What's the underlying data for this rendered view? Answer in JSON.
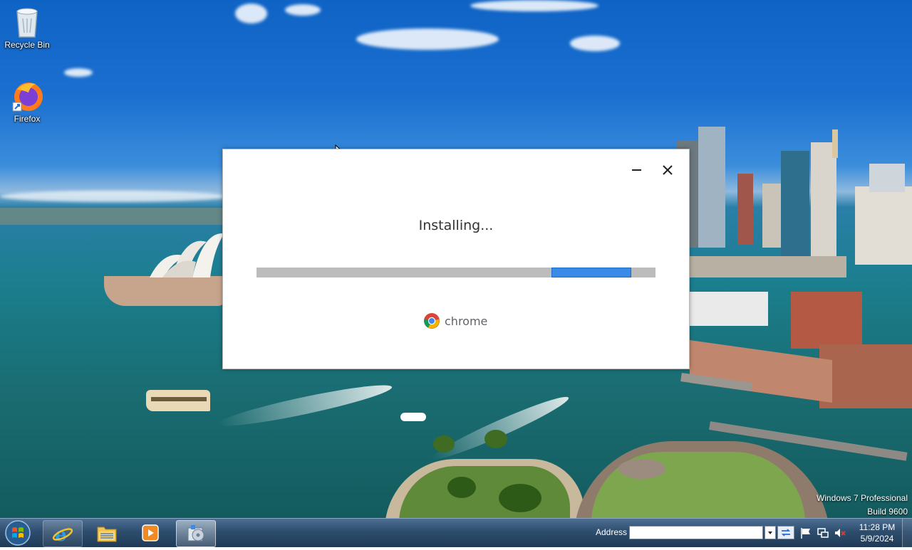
{
  "desktop": {
    "icons": [
      {
        "label": "Recycle Bin",
        "icon": "recycle-bin-icon"
      },
      {
        "label": "Firefox",
        "icon": "firefox-icon"
      }
    ],
    "watermark": {
      "line1": "Windows 7 Professional",
      "line2": "Build 9600"
    }
  },
  "installer": {
    "status": "Installing...",
    "progress": {
      "start_fraction": 0.74,
      "end_fraction": 0.94
    },
    "brand": "chrome",
    "colors": {
      "progress_fill": "#3c8ae8",
      "progress_track": "#bcbcbc"
    }
  },
  "taskbar": {
    "items": [
      {
        "name": "internet-explorer",
        "icon": "internet-explorer-icon"
      },
      {
        "name": "file-explorer",
        "icon": "folder-icon"
      },
      {
        "name": "media-player",
        "icon": "media-player-icon"
      },
      {
        "name": "chrome-installer",
        "icon": "installer-icon"
      }
    ],
    "address_label": "Address",
    "address_value": "",
    "clock": {
      "time": "11:28 PM",
      "date": "5/9/2024"
    }
  }
}
